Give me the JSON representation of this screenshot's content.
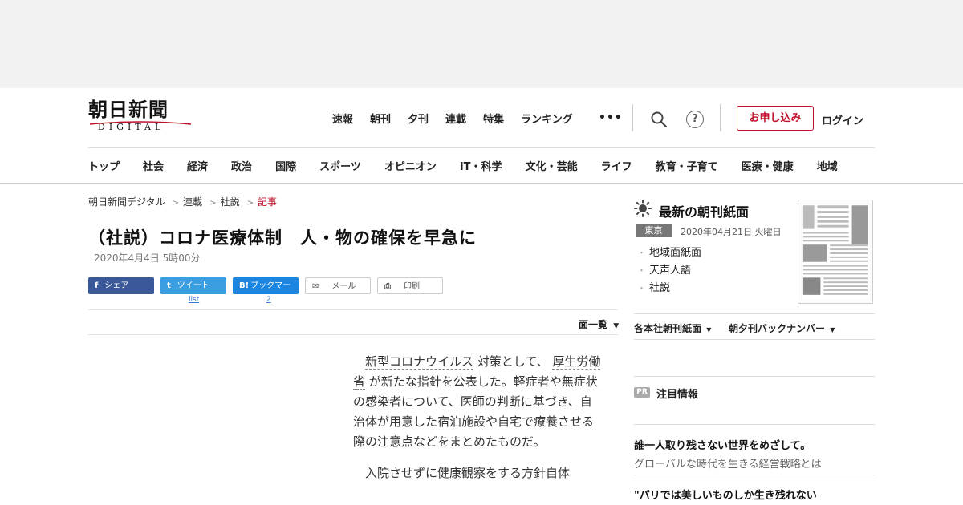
{
  "logo": {
    "jp": "朝日新聞",
    "en": "DIGITAL"
  },
  "topnav": [
    "速報",
    "朝刊",
    "夕刊",
    "連載",
    "特集",
    "ランキング"
  ],
  "more_label": "•••",
  "help_label": "?",
  "apply_label": "お申し込み",
  "login_label": "ログイン",
  "catnav": [
    "トップ",
    "社会",
    "経済",
    "政治",
    "国際",
    "スポーツ",
    "オピニオン",
    "IT・科学",
    "文化・芸能",
    "ライフ",
    "教育・子育て",
    "医療・健康",
    "地域"
  ],
  "breadcrumb": [
    "朝日新聞デジタル",
    "連載",
    "社説",
    "記事"
  ],
  "breadcrumb_sep": ">",
  "article": {
    "title": "（社説）コロナ医療体制　人・物の確保を早急に",
    "date": "2020年4月4日 5時00分",
    "p1_kw1": "新型コロナウイルス",
    "p1_a": " 対策として、 ",
    "p1_kw2": "厚生労働省",
    "p1_b": " が新たな指針を公表した。軽症者や無症状の感染者について、医師の判断に基づき、自治体が用意した宿泊施設や自宅で療養させる際の注意点などをまとめたものだ。",
    "p2": "入院させずに健康観察をする方針自体"
  },
  "share": {
    "facebook": {
      "icon": "f",
      "label": "シェア"
    },
    "twitter": {
      "icon": "t",
      "label": "ツイート",
      "count": "list"
    },
    "hatena": {
      "icon": "B!",
      "label": "ブックマーク",
      "count": "2"
    },
    "mail": {
      "label": "メール"
    },
    "print": {
      "label": "印刷"
    }
  },
  "menlist_label": "面一覧",
  "sidebar": {
    "title": "最新の朝刊紙面",
    "edition": "東京",
    "paper_date": "2020年04月21日 火曜日",
    "links": [
      "地域面紙面",
      "天声人語",
      "社説"
    ],
    "drop1": "各本社朝刊紙面",
    "drop2": "朝夕刊バックナンバー",
    "pr_badge": "PR",
    "pr_label": "注目情報",
    "pr1_title": "誰一人取り残さない世界をめざして。",
    "pr1_sub": "グローバルな時代を生きる経営戦略とは",
    "pr2_title": "\"パリでは美しいものしか生き残れない"
  },
  "colors": {
    "accent": "#c0102a",
    "facebook": "#3b5998",
    "twitter": "#3a9ee0",
    "hatena": "#1b85e0"
  }
}
